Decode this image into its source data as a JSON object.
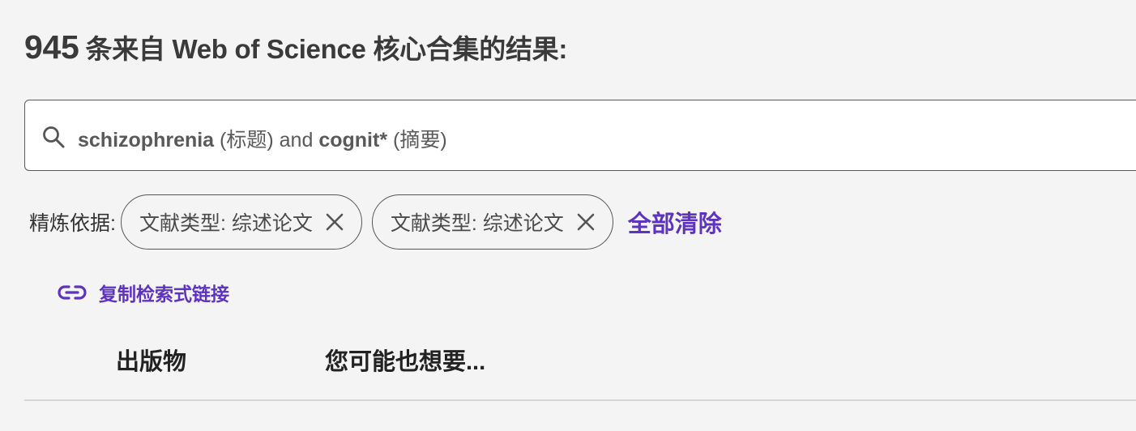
{
  "results": {
    "count": "945",
    "title_suffix": "条来自 Web of Science 核心合集的结果:"
  },
  "search": {
    "icon": "search-icon",
    "term1": "schizophrenia",
    "field1": "(标题)",
    "operator": "and",
    "term2": "cognit*",
    "field2": "(摘要)"
  },
  "refine": {
    "label": "精炼依据:",
    "chips": [
      {
        "label": "文献类型: 综述论文",
        "icon": "close-icon"
      },
      {
        "label": "文献类型: 综述论文",
        "icon": "close-icon"
      }
    ],
    "clear_all": "全部清除"
  },
  "copy_link": {
    "icon": "link-icon",
    "label": "复制检索式链接"
  },
  "tabs": [
    {
      "label": "出版物"
    },
    {
      "label": "您可能也想要..."
    }
  ],
  "colors": {
    "accent": "#5e33bf",
    "background": "#f4f4f4",
    "text": "#333333",
    "divider": "#d6d6d6"
  }
}
